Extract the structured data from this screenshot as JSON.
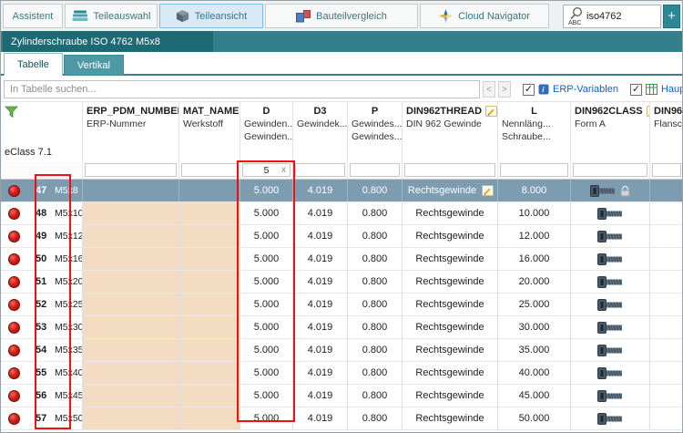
{
  "colors": {
    "teal_strip": "#31808c",
    "doc_tab": "#1d6974",
    "active_top_tab": "#d8e9f7",
    "selected_row": "#7e9cb0",
    "tan_cell": "#f4dcc2",
    "status_dot": "#d0201a",
    "annotation": "#f10f0f",
    "link_blue": "#0f62c0",
    "add_button": "#2e8794"
  },
  "icons": {
    "teileauswahl": "stacked-layers",
    "teileansicht": "cube",
    "bauteilvergleich": "compare-squares",
    "cloud_navigator": "compass-star",
    "quick_search": "magnifier-abc",
    "table_corner": "filter-funnel",
    "edit": "orange-pencil",
    "row_status": "red-dot",
    "part_preview": "screw-side-view",
    "locked": "padlock",
    "erp_toggle": "info-blue-square",
    "main_toggle": "green-grid"
  },
  "top_bar": {
    "tabs": [
      {
        "label": "Assistent",
        "active": false
      },
      {
        "label": "Teileauswahl",
        "active": false
      },
      {
        "label": "Teileansicht",
        "active": true
      },
      {
        "label": "Bauteilvergleich",
        "active": false
      },
      {
        "label": "Cloud Navigator",
        "active": false
      }
    ],
    "search_value": "iso4762",
    "add_label": "+"
  },
  "document_tab": {
    "title": "Zylinderschraube ISO 4762 M5x8"
  },
  "view_tabs": [
    {
      "label": "Tabelle",
      "active": true
    },
    {
      "label": "Vertikal",
      "active": false
    }
  ],
  "search_row": {
    "placeholder": "In Tabelle suchen...",
    "prev": "<",
    "next": ">",
    "erp_label": "ERP-Variablen",
    "erp_checked": true,
    "main_label": "Haup",
    "main_checked": true,
    "check_glyph": "✓"
  },
  "table": {
    "corner_label": "eClass 7.1",
    "columns": [
      {
        "key": "ERP_PDM_NUMBER",
        "desc1": "ERP-Nummer",
        "desc2": ""
      },
      {
        "key": "MAT_NAME",
        "desc1": "Werkstoff",
        "desc2": ""
      },
      {
        "key": "D",
        "desc1": "Gewinden...",
        "desc2": "Gewinden..."
      },
      {
        "key": "D3",
        "desc1": "Gewindek...",
        "desc2": ""
      },
      {
        "key": "P",
        "desc1": "Gewindes...",
        "desc2": "Gewindes..."
      },
      {
        "key": "DIN962THREAD",
        "desc1": "DIN 962 Gewinde",
        "desc2": "",
        "editable": true
      },
      {
        "key": "L",
        "desc1": "Nennläng...",
        "desc2": "Schraube..."
      },
      {
        "key": "DIN962CLASS",
        "desc1": "Form A",
        "desc2": "",
        "editable": true
      },
      {
        "key": "DIN96",
        "desc1": "Flansch...",
        "desc2": ""
      }
    ],
    "filter": {
      "value": "5",
      "clear": "x"
    },
    "rows": [
      {
        "num": "47",
        "name": "M5x8",
        "d": "5.000",
        "d3": "4.019",
        "p": "0.800",
        "thread": "Rechtsgewinde",
        "l": "8.000",
        "selected": true,
        "locked": true
      },
      {
        "num": "48",
        "name": "M5x10",
        "d": "5.000",
        "d3": "4.019",
        "p": "0.800",
        "thread": "Rechtsgewinde",
        "l": "10.000"
      },
      {
        "num": "49",
        "name": "M5x12",
        "d": "5.000",
        "d3": "4.019",
        "p": "0.800",
        "thread": "Rechtsgewinde",
        "l": "12.000"
      },
      {
        "num": "50",
        "name": "M5x16",
        "d": "5.000",
        "d3": "4.019",
        "p": "0.800",
        "thread": "Rechtsgewinde",
        "l": "16.000"
      },
      {
        "num": "51",
        "name": "M5x20",
        "d": "5.000",
        "d3": "4.019",
        "p": "0.800",
        "thread": "Rechtsgewinde",
        "l": "20.000"
      },
      {
        "num": "52",
        "name": "M5x25",
        "d": "5.000",
        "d3": "4.019",
        "p": "0.800",
        "thread": "Rechtsgewinde",
        "l": "25.000"
      },
      {
        "num": "53",
        "name": "M5x30",
        "d": "5.000",
        "d3": "4.019",
        "p": "0.800",
        "thread": "Rechtsgewinde",
        "l": "30.000"
      },
      {
        "num": "54",
        "name": "M5x35",
        "d": "5.000",
        "d3": "4.019",
        "p": "0.800",
        "thread": "Rechtsgewinde",
        "l": "35.000"
      },
      {
        "num": "55",
        "name": "M5x40",
        "d": "5.000",
        "d3": "4.019",
        "p": "0.800",
        "thread": "Rechtsgewinde",
        "l": "40.000"
      },
      {
        "num": "56",
        "name": "M5x45",
        "d": "5.000",
        "d3": "4.019",
        "p": "0.800",
        "thread": "Rechtsgewinde",
        "l": "45.000"
      },
      {
        "num": "57",
        "name": "M5x50",
        "d": "5.000",
        "d3": "4.019",
        "p": "0.800",
        "thread": "Rechtsgewinde",
        "l": "50.000"
      }
    ]
  }
}
